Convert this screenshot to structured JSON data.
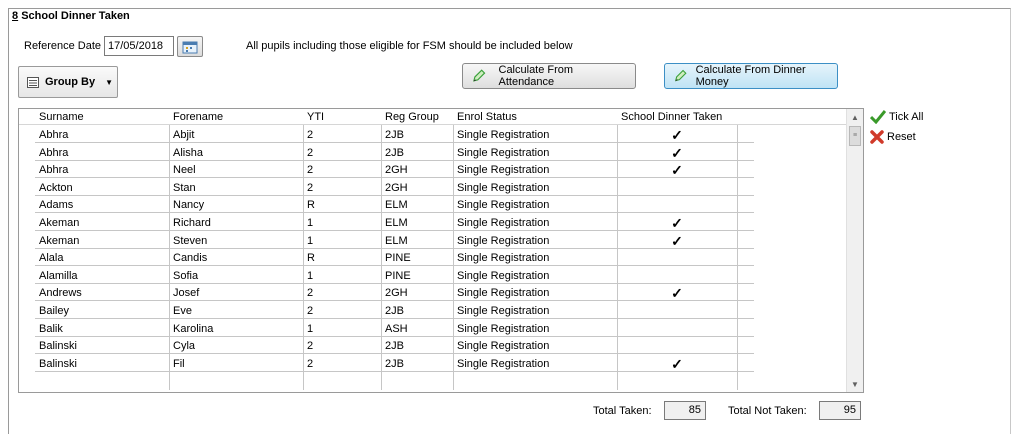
{
  "section": {
    "number": "8",
    "title": "School Dinner Taken"
  },
  "reference_date": {
    "label": "Reference Date",
    "value": "17/05/2018"
  },
  "info_text": "All pupils including those eligible for FSM should be included below",
  "group_by": {
    "label": "Group By"
  },
  "buttons": {
    "calc_attendance": "Calculate From Attendance",
    "calc_dinner_money": "Calculate From Dinner Money",
    "tick_all": "Tick All",
    "reset": "Reset"
  },
  "columns": [
    "Surname",
    "Forename",
    "YTI",
    "Reg Group",
    "Enrol Status",
    "School Dinner Taken"
  ],
  "tick_glyph": "✓",
  "rows": [
    {
      "surname": "Abhra",
      "forename": "Abjit",
      "yti": "2",
      "reg_group": "2JB",
      "enrol_status": "Single Registration",
      "dinner": true
    },
    {
      "surname": "Abhra",
      "forename": "Alisha",
      "yti": "2",
      "reg_group": "2JB",
      "enrol_status": "Single Registration",
      "dinner": true
    },
    {
      "surname": "Abhra",
      "forename": "Neel",
      "yti": "2",
      "reg_group": "2GH",
      "enrol_status": "Single Registration",
      "dinner": true
    },
    {
      "surname": "Ackton",
      "forename": "Stan",
      "yti": "2",
      "reg_group": "2GH",
      "enrol_status": "Single Registration",
      "dinner": false
    },
    {
      "surname": "Adams",
      "forename": "Nancy",
      "yti": "R",
      "reg_group": "ELM",
      "enrol_status": "Single Registration",
      "dinner": false
    },
    {
      "surname": "Akeman",
      "forename": "Richard",
      "yti": "1",
      "reg_group": "ELM",
      "enrol_status": "Single Registration",
      "dinner": true
    },
    {
      "surname": "Akeman",
      "forename": "Steven",
      "yti": "1",
      "reg_group": "ELM",
      "enrol_status": "Single Registration",
      "dinner": true
    },
    {
      "surname": "Alala",
      "forename": "Candis",
      "yti": "R",
      "reg_group": "PINE",
      "enrol_status": "Single Registration",
      "dinner": false
    },
    {
      "surname": "Alamilla",
      "forename": "Sofia",
      "yti": "1",
      "reg_group": "PINE",
      "enrol_status": "Single Registration",
      "dinner": false
    },
    {
      "surname": "Andrews",
      "forename": "Josef",
      "yti": "2",
      "reg_group": "2GH",
      "enrol_status": "Single Registration",
      "dinner": true
    },
    {
      "surname": "Bailey",
      "forename": "Eve",
      "yti": "2",
      "reg_group": "2JB",
      "enrol_status": "Single Registration",
      "dinner": false
    },
    {
      "surname": "Balik",
      "forename": "Karolina",
      "yti": "1",
      "reg_group": "ASH",
      "enrol_status": "Single Registration",
      "dinner": false
    },
    {
      "surname": "Balinski",
      "forename": "Cyla",
      "yti": "2",
      "reg_group": "2JB",
      "enrol_status": "Single Registration",
      "dinner": false
    },
    {
      "surname": "Balinski",
      "forename": "Fil",
      "yti": "2",
      "reg_group": "2JB",
      "enrol_status": "Single Registration",
      "dinner": true
    }
  ],
  "totals": {
    "taken_label": "Total Taken:",
    "taken_value": "85",
    "not_taken_label": "Total Not Taken:",
    "not_taken_value": "95"
  },
  "colors": {
    "tick_all_icon": "#3a9a2a",
    "reset_icon": "#d03a2a",
    "pencil_icon": "#3aa03a",
    "highlight_border": "#3c8fc5"
  }
}
